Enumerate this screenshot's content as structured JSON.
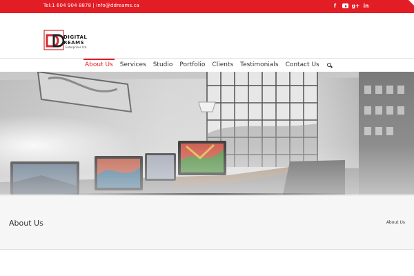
{
  "topbar": {
    "contact_text": "Tel:1 604 904 8878 | info@ddreams.ca",
    "social": [
      {
        "name": "facebook-icon",
        "glyph": "f"
      },
      {
        "name": "youtube-icon",
        "glyph": ""
      },
      {
        "name": "google-plus-icon",
        "glyph": "g+"
      },
      {
        "name": "linkedin-icon",
        "glyph": "in"
      }
    ],
    "color": "#e21d25"
  },
  "logo": {
    "line1": "DIGITAL",
    "line2": "REAMS",
    "line3": "Enterprises Ltd."
  },
  "nav": {
    "items": [
      "About Us",
      "Services",
      "Studio",
      "Portfolio",
      "Clients",
      "Testimonials",
      "Contact Us"
    ],
    "active_index": 0,
    "accent": "#e21d25"
  },
  "page": {
    "title": "About Us",
    "breadcrumb": "About Us"
  }
}
